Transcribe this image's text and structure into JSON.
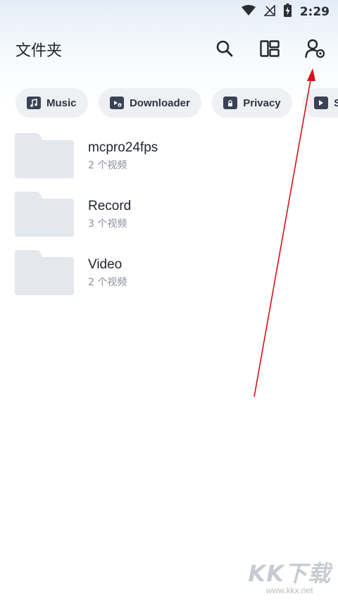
{
  "status_bar": {
    "time": "2:29"
  },
  "app_bar": {
    "title": "文件夹"
  },
  "chips": [
    {
      "label": "Music",
      "icon": "music-note-icon"
    },
    {
      "label": "Downloader",
      "icon": "download-icon"
    },
    {
      "label": "Privacy",
      "icon": "lock-icon"
    },
    {
      "label": "Sh",
      "icon": "share-icon"
    }
  ],
  "folders": [
    {
      "name": "mcpro24fps",
      "count": "2 个视频"
    },
    {
      "name": "Record",
      "count": "3 个视频"
    },
    {
      "name": "Video",
      "count": "2 个视频"
    }
  ],
  "annotation": {
    "color": "#d0141c"
  },
  "watermark": {
    "logo": "KK下载",
    "url": "www.kkx.net"
  },
  "colors": {
    "folder": "#e4e7eb",
    "chip_bg": "#eef0f3",
    "chip_icon": "#3a4257"
  }
}
